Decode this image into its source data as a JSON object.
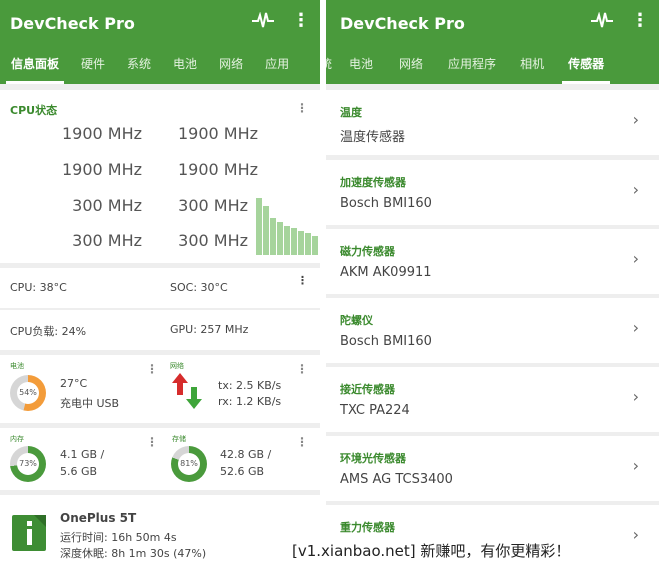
{
  "left": {
    "app_title": "DevCheck Pro",
    "tabs": [
      "信息面板",
      "硬件",
      "系统",
      "电池",
      "网络",
      "应用"
    ],
    "cpu_card": {
      "title": "CPU状态",
      "frequencies": [
        "1900 MHz",
        "1900 MHz",
        "1900 MHz",
        "1900 MHz",
        "300 MHz",
        "300 MHz",
        "300 MHz",
        "300 MHz"
      ],
      "usage_bars_fraction": [
        0.95,
        0.82,
        0.62,
        0.55,
        0.48,
        0.45,
        0.4,
        0.36,
        0.32
      ]
    },
    "temps": {
      "cpu": "CPU: 38°C",
      "soc": "SOC: 30°C"
    },
    "load": {
      "cpu_load": "CPU负载: 24%",
      "gpu": "GPU: 257 MHz"
    },
    "battery": {
      "label": "电池",
      "percent": "54%",
      "percent_value": 54,
      "temp": "27°C",
      "status": "充电中 USB"
    },
    "network": {
      "label": "网络",
      "tx": "tx: 2.5 KB/s",
      "rx": "rx: 1.2 KB/s"
    },
    "memory": {
      "label": "内存",
      "percent": "73%",
      "percent_value": 73,
      "used": "4.1 GB /",
      "total": "5.6 GB"
    },
    "storage": {
      "label": "存储",
      "percent": "81%",
      "percent_value": 81,
      "used": "42.8 GB /",
      "total": "52.6 GB"
    },
    "device": {
      "name": "OnePlus 5T",
      "uptime": "运行时间: 16h 50m 4s",
      "deep_sleep": "深度休眠: 8h 1m 30s (47%)"
    }
  },
  "right": {
    "app_title": "DevCheck Pro",
    "tabs": [
      "统",
      "电池",
      "网络",
      "应用程序",
      "相机",
      "传感器"
    ],
    "sensors": [
      {
        "category": "温度",
        "value": "温度传感器"
      },
      {
        "category": "加速度传感器",
        "value": "Bosch BMI160"
      },
      {
        "category": "磁力传感器",
        "value": "AKM AK09911"
      },
      {
        "category": "陀螺仪",
        "value": "Bosch BMI160"
      },
      {
        "category": "接近传感器",
        "value": "TXC PA224"
      },
      {
        "category": "环境光传感器",
        "value": "AMS AG TCS3400"
      },
      {
        "category": "重力传感器",
        "value": ""
      }
    ]
  },
  "watermark": "[v1.xianbao.net] 新赚吧，有你更精彩！",
  "colors": {
    "primary": "#4a9a3c",
    "accent_text": "#3b8a2e",
    "bars": "#a6d49c",
    "battery_ring": "#f39c3a",
    "memory_ring": "#4a9a3c"
  },
  "icons": [
    "pulse-icon",
    "more-vert-icon",
    "chevron-right-icon",
    "up-arrow-icon",
    "down-arrow-icon",
    "device-icon"
  ]
}
